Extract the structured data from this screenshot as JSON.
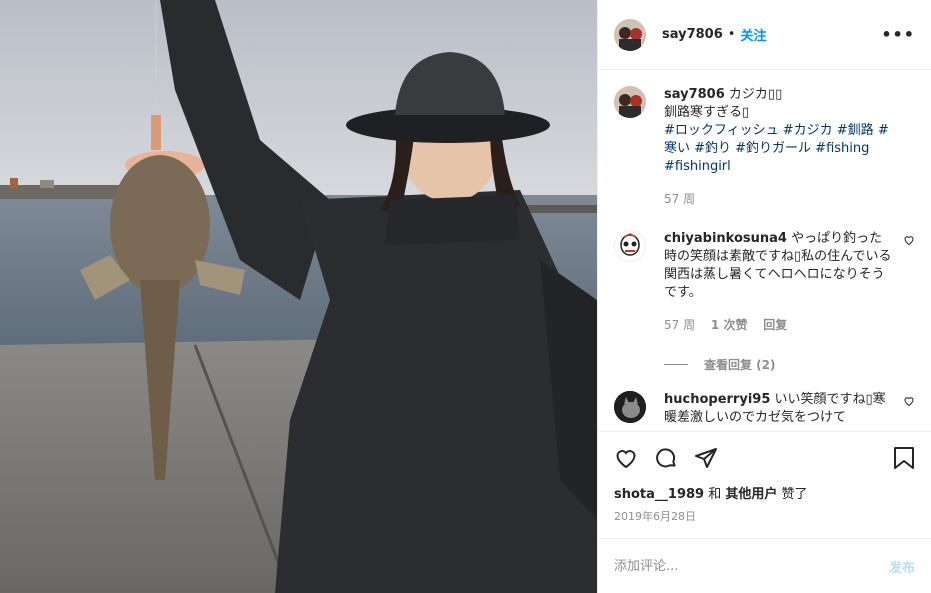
{
  "header": {
    "username": "say7806",
    "separator": "•",
    "follow_label": "关注",
    "more_label": "•••"
  },
  "caption": {
    "username": "say7806",
    "line1": "カジカ▯▯",
    "line2": "釧路寒すぎる▯",
    "hashtags_line": "#ロックフィッシュ #カジカ #釧路 #寒い #釣り #釣りガール #fishing #fishingirl",
    "time": "57 周"
  },
  "comments": [
    {
      "username": "chiyabinkosuna4",
      "text": "やっぱり釣った時の笑顔は素敵ですね▯私の住んでいる関西は蒸し暑くてヘロヘロになりそうです。",
      "time": "57 周",
      "likes": "1 次赞",
      "reply": "回复",
      "view_replies": "查看回复 (2)"
    },
    {
      "username": "huchoperryi95",
      "text": "いい笑顔ですね▯寒暖差激しいのでカゼ気をつけて"
    }
  ],
  "likes_line": {
    "user": "shota__1989",
    "conj": "和",
    "others": "其他用户",
    "suffix": "赞了"
  },
  "date": "2019年6月28日",
  "add_comment": {
    "placeholder": "添加评论...",
    "post_label": "发布"
  },
  "colors": {
    "link_blue": "#0095f6",
    "hashtag": "#00376b",
    "muted": "#8e8e8e",
    "post_disabled": "#b2dffc"
  }
}
